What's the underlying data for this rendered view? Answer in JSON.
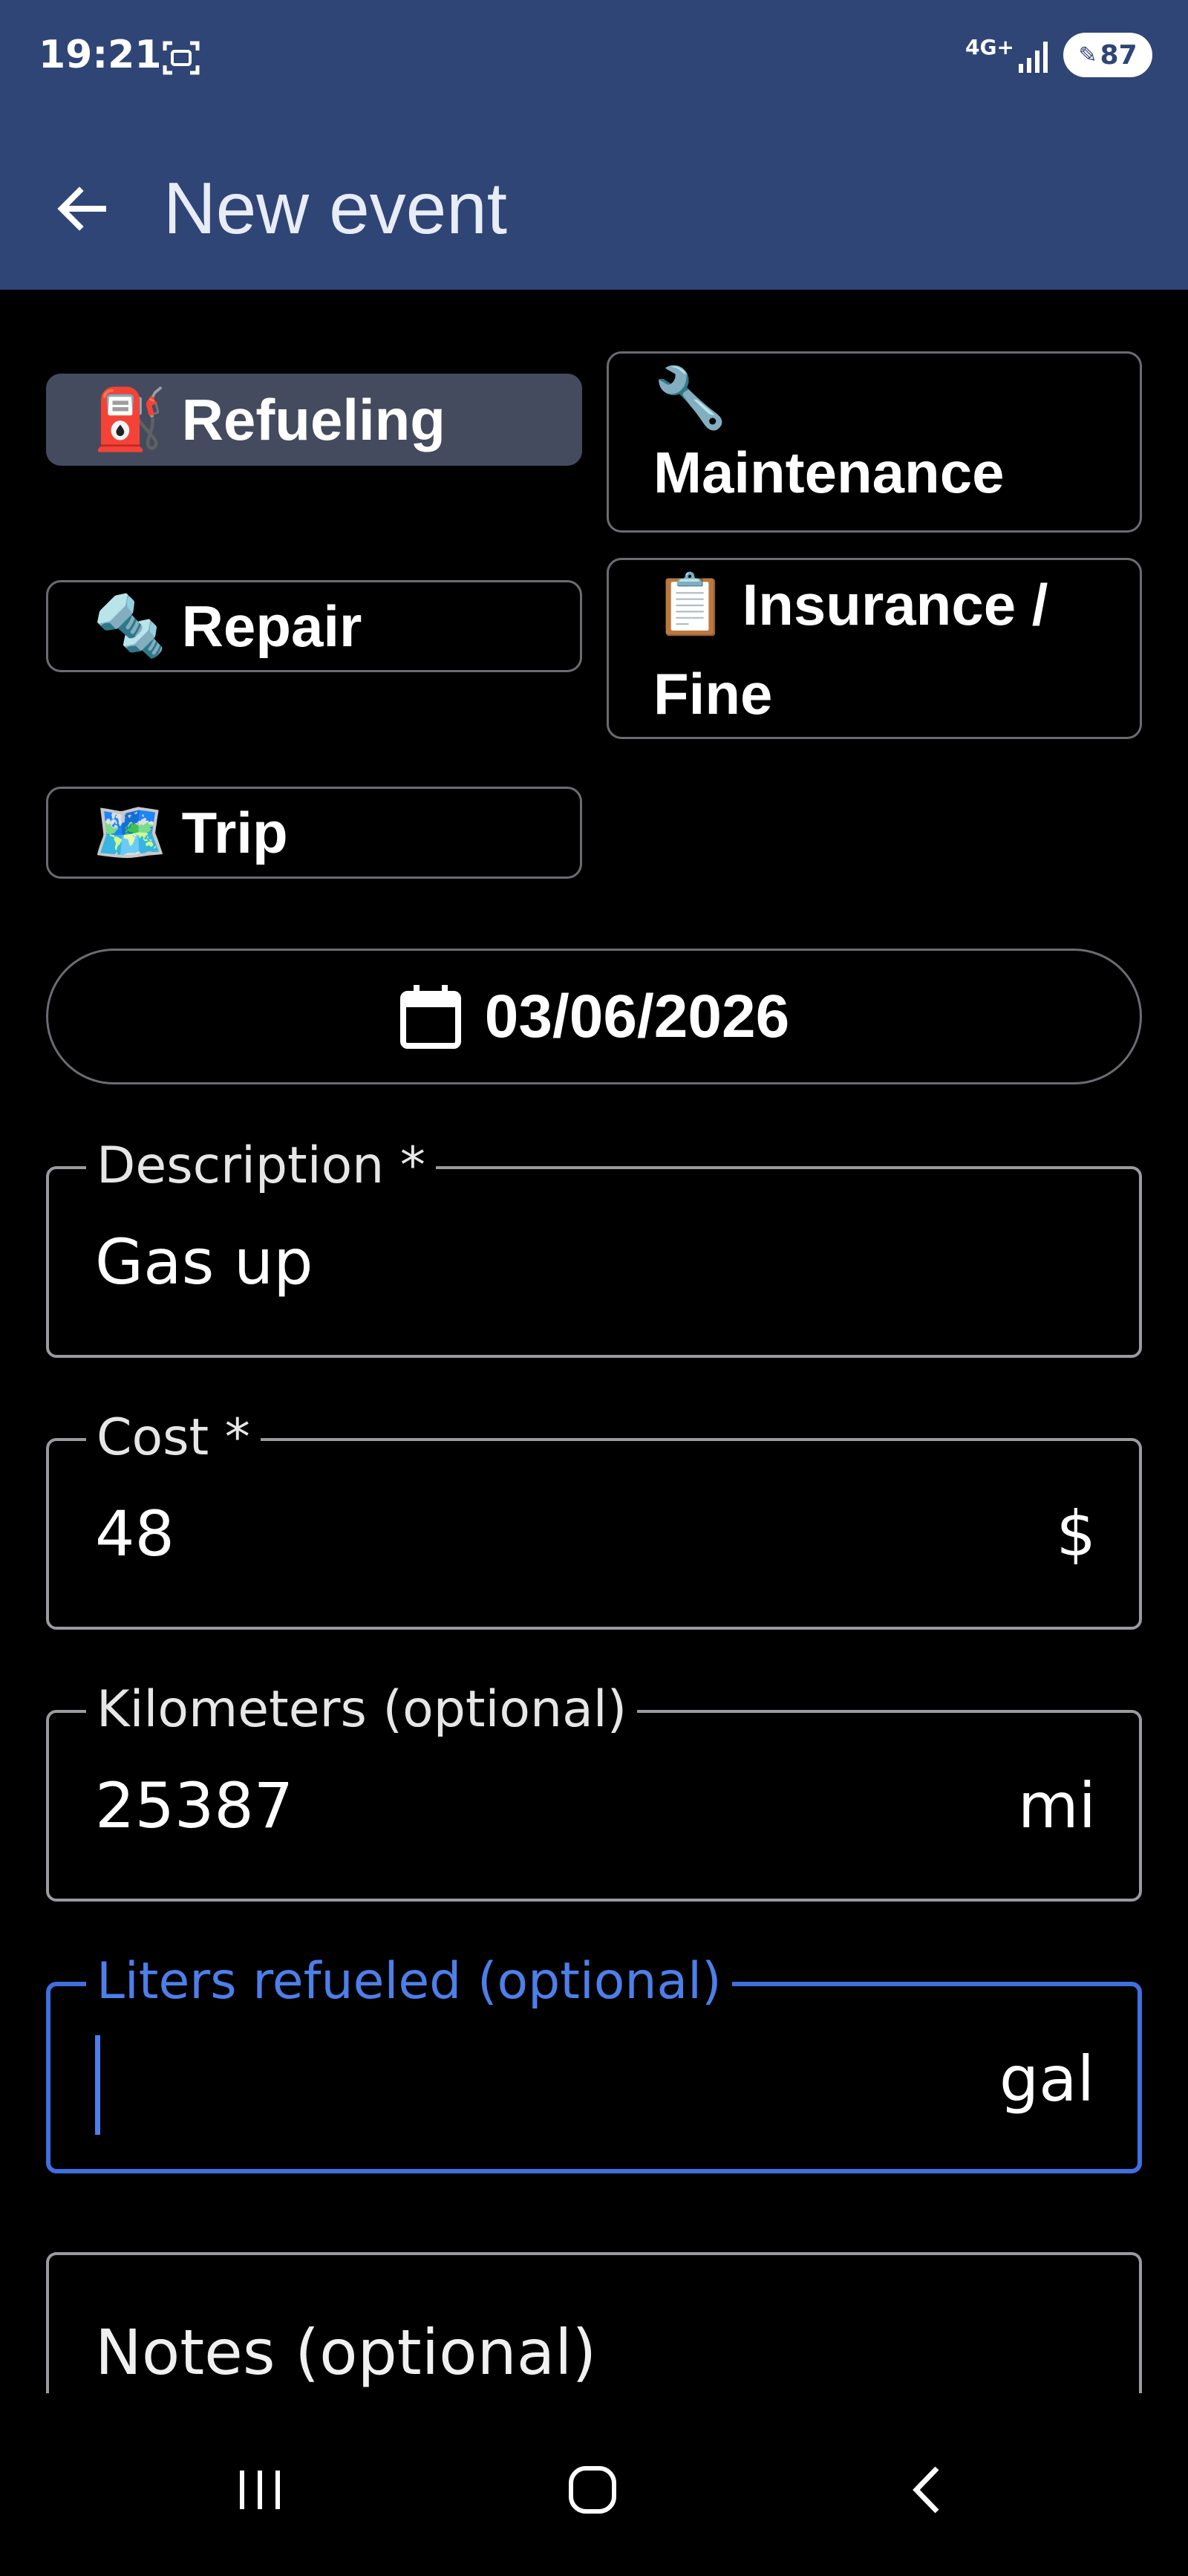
{
  "status_bar": {
    "time": "19:21",
    "network": "4G+",
    "battery": "87"
  },
  "app_bar": {
    "title": "New event"
  },
  "categories": [
    {
      "emoji": "⛽",
      "label": "Refueling",
      "selected": true
    },
    {
      "emoji": "🔧",
      "label": "Maintenance",
      "selected": false
    },
    {
      "emoji": "🔩",
      "label": "Repair",
      "selected": false
    },
    {
      "emoji": "📋",
      "label": "Insurance / Fine",
      "selected": false
    },
    {
      "emoji": "🗺️",
      "label": "Trip",
      "selected": false
    }
  ],
  "date": "03/06/2026",
  "fields": {
    "description": {
      "label": "Description *",
      "value": "Gas up"
    },
    "cost": {
      "label": "Cost *",
      "value": "48",
      "suffix": "$"
    },
    "kilometers": {
      "label": "Kilometers (optional)",
      "value": "25387",
      "suffix": "mi"
    },
    "liters": {
      "label": "Liters refueled (optional)",
      "value": "",
      "suffix": "gal"
    },
    "notes": {
      "placeholder": "Notes (optional)"
    }
  },
  "colors": {
    "app_bar": "#2f4576",
    "selected_chip": "#454b5e",
    "focus": "#3f6fe0"
  }
}
